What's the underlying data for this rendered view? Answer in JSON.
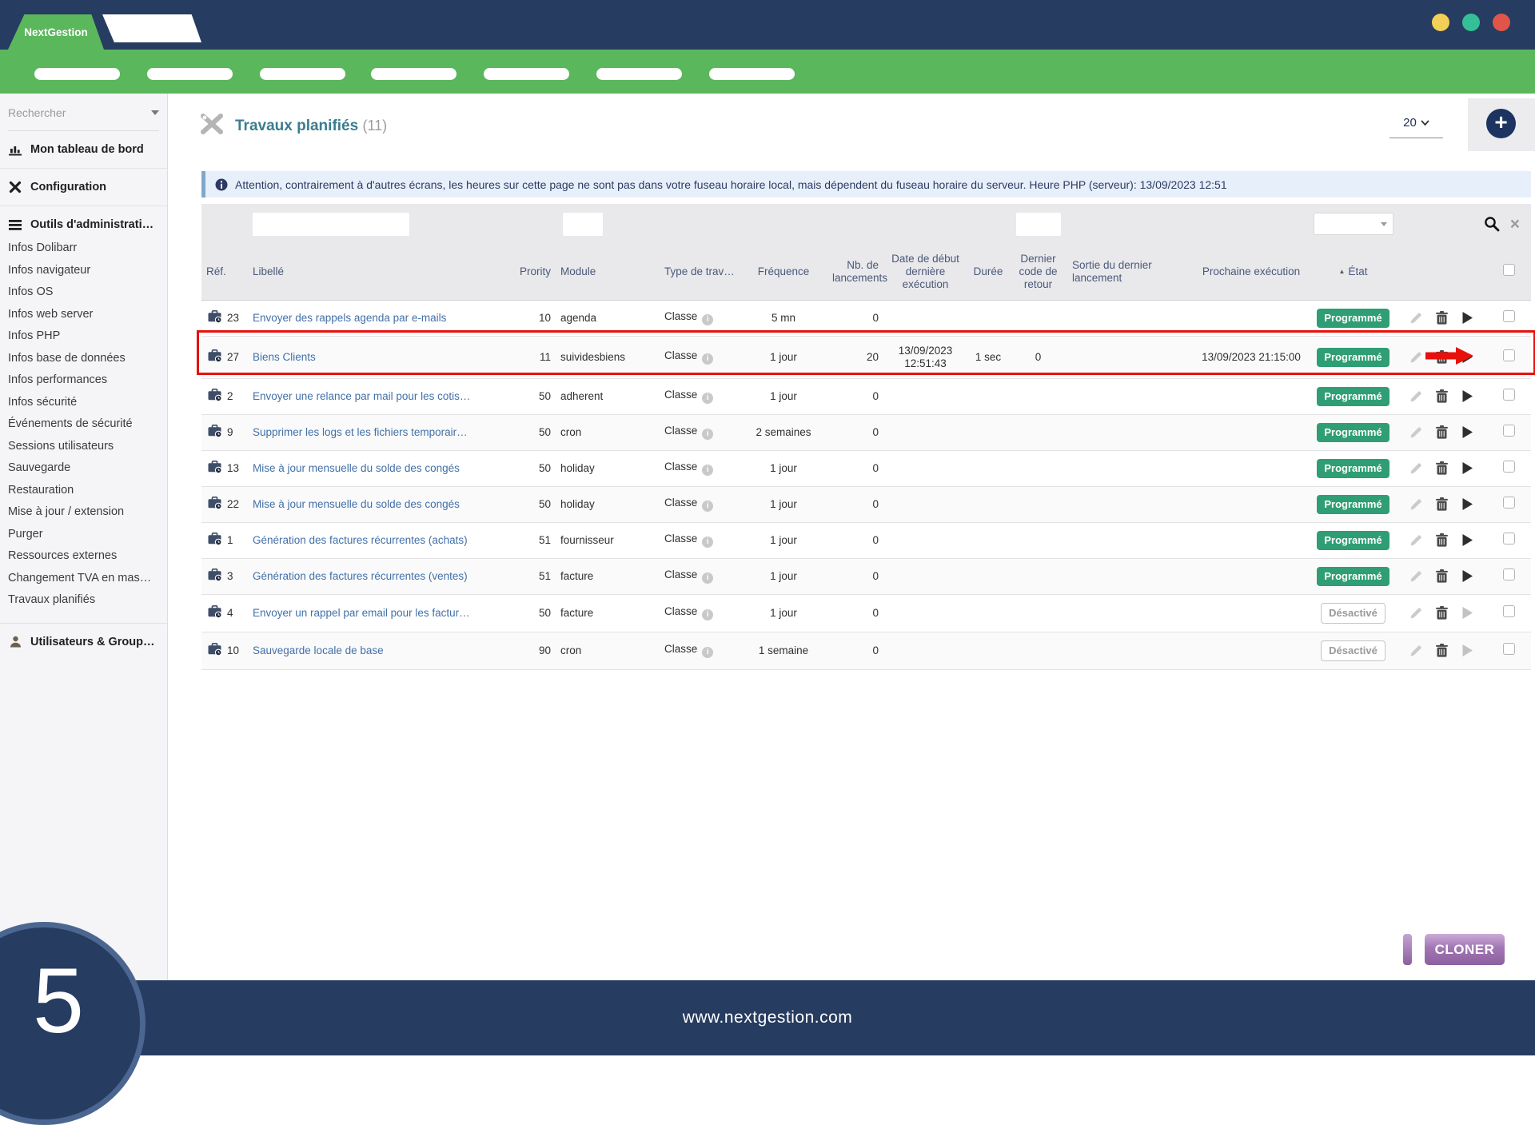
{
  "topbar": {
    "brand": "NextGestion",
    "traffic_lights": {
      "yellow": "#f2cf56",
      "teal": "#35bf96",
      "red": "#e15549"
    }
  },
  "sidebar": {
    "search_placeholder": "Rechercher",
    "sections": [
      {
        "icon": "bar-chart-icon",
        "label": "Mon tableau de bord"
      },
      {
        "icon": "tools-icon",
        "label": "Configuration"
      },
      {
        "icon": "list-icon",
        "label": "Outils d'administrati…"
      }
    ],
    "admin_items": [
      "Infos Dolibarr",
      "Infos navigateur",
      "Infos OS",
      "Infos web server",
      "Infos PHP",
      "Infos base de données",
      "Infos performances",
      "Infos sécurité",
      "Événements de sécurité",
      "Sessions utilisateurs",
      "Sauvegarde",
      "Restauration",
      "Mise à jour / extension",
      "Purger",
      "Ressources externes",
      "Changement TVA en mas…",
      "Travaux planifiés"
    ],
    "users_section": {
      "icon": "user-icon",
      "label": "Utilisateurs & Group…"
    }
  },
  "page": {
    "title": "Travaux planifiés",
    "count": "(11)",
    "page_size": "20",
    "add_label": "+",
    "notice": "Attention, contrairement à d'autres écrans, les heures sur cette page ne sont pas dans votre fuseau horaire local, mais dépendent du fuseau horaire du serveur. Heure PHP (serveur): 13/09/2023 12:51"
  },
  "table": {
    "headers": [
      "Réf.",
      "Libellé",
      "Prority",
      "Module",
      "Type de trav…",
      "Fréquence",
      "Nb. de lancements",
      "Date de début dernière exécution",
      "Durée",
      "Dernier code de retour",
      "Sortie du dernier lancement",
      "Prochaine exécution",
      "État"
    ],
    "sort_indicator": "▲",
    "info_glyph": "i",
    "close_glyph": "×",
    "rows": [
      {
        "ref": "23",
        "label": "Envoyer des rappels agenda par e-mails",
        "priority": "10",
        "module": "agenda",
        "type": "Classe",
        "freq": "5 mn",
        "launches": "0",
        "last_start": "",
        "duration": "",
        "return_code": "",
        "last_output": "",
        "next_run": "",
        "state": "Programmé",
        "state_type": "on",
        "highlighted": false
      },
      {
        "ref": "27",
        "label": "Biens Clients",
        "priority": "11",
        "module": "suividesbiens",
        "type": "Classe",
        "freq": "1 jour",
        "launches": "20",
        "last_start": "13/09/2023 12:51:43",
        "duration": "1 sec",
        "return_code": "0",
        "last_output": "",
        "next_run": "13/09/2023 21:15:00",
        "state": "Programmé",
        "state_type": "on",
        "highlighted": true
      },
      {
        "ref": "2",
        "label": "Envoyer une relance par mail pour les cotis…",
        "priority": "50",
        "module": "adherent",
        "type": "Classe",
        "freq": "1 jour",
        "launches": "0",
        "last_start": "",
        "duration": "",
        "return_code": "",
        "last_output": "",
        "next_run": "",
        "state": "Programmé",
        "state_type": "on",
        "highlighted": false
      },
      {
        "ref": "9",
        "label": "Supprimer les logs et les fichiers temporair…",
        "priority": "50",
        "module": "cron",
        "type": "Classe",
        "freq": "2 semaines",
        "launches": "0",
        "last_start": "",
        "duration": "",
        "return_code": "",
        "last_output": "",
        "next_run": "",
        "state": "Programmé",
        "state_type": "on",
        "highlighted": false
      },
      {
        "ref": "13",
        "label": "Mise à jour mensuelle du solde des congés",
        "priority": "50",
        "module": "holiday",
        "type": "Classe",
        "freq": "1 jour",
        "launches": "0",
        "last_start": "",
        "duration": "",
        "return_code": "",
        "last_output": "",
        "next_run": "",
        "state": "Programmé",
        "state_type": "on",
        "highlighted": false
      },
      {
        "ref": "22",
        "label": "Mise à jour mensuelle du solde des congés",
        "priority": "50",
        "module": "holiday",
        "type": "Classe",
        "freq": "1 jour",
        "launches": "0",
        "last_start": "",
        "duration": "",
        "return_code": "",
        "last_output": "",
        "next_run": "",
        "state": "Programmé",
        "state_type": "on",
        "highlighted": false
      },
      {
        "ref": "1",
        "label": "Génération des factures récurrentes (achats)",
        "priority": "51",
        "module": "fournisseur",
        "type": "Classe",
        "freq": "1 jour",
        "launches": "0",
        "last_start": "",
        "duration": "",
        "return_code": "",
        "last_output": "",
        "next_run": "",
        "state": "Programmé",
        "state_type": "on",
        "highlighted": false
      },
      {
        "ref": "3",
        "label": "Génération des factures récurrentes (ventes)",
        "priority": "51",
        "module": "facture",
        "type": "Classe",
        "freq": "1 jour",
        "launches": "0",
        "last_start": "",
        "duration": "",
        "return_code": "",
        "last_output": "",
        "next_run": "",
        "state": "Programmé",
        "state_type": "on",
        "highlighted": false
      },
      {
        "ref": "4",
        "label": "Envoyer un rappel par email pour les factur…",
        "priority": "50",
        "module": "facture",
        "type": "Classe",
        "freq": "1 jour",
        "launches": "0",
        "last_start": "",
        "duration": "",
        "return_code": "",
        "last_output": "",
        "next_run": "",
        "state": "Désactivé",
        "state_type": "off",
        "highlighted": false
      },
      {
        "ref": "10",
        "label": "Sauvegarde locale de base",
        "priority": "90",
        "module": "cron",
        "type": "Classe",
        "freq": "1 semaine",
        "launches": "0",
        "last_start": "",
        "duration": "",
        "return_code": "",
        "last_output": "",
        "next_run": "",
        "state": "Désactivé",
        "state_type": "off",
        "highlighted": false
      }
    ]
  },
  "actions": {
    "clone_label": "CLONER"
  },
  "footer": {
    "url": "www.nextgestion.com",
    "badge_number": "5"
  },
  "colors": {
    "accent_green": "#5bb75c",
    "navy": "#263c60",
    "badge_on": "#2f9e74",
    "highlight_red": "#e8100c",
    "clone_purple": "#8d5fa0",
    "link_blue": "#4270a8"
  }
}
